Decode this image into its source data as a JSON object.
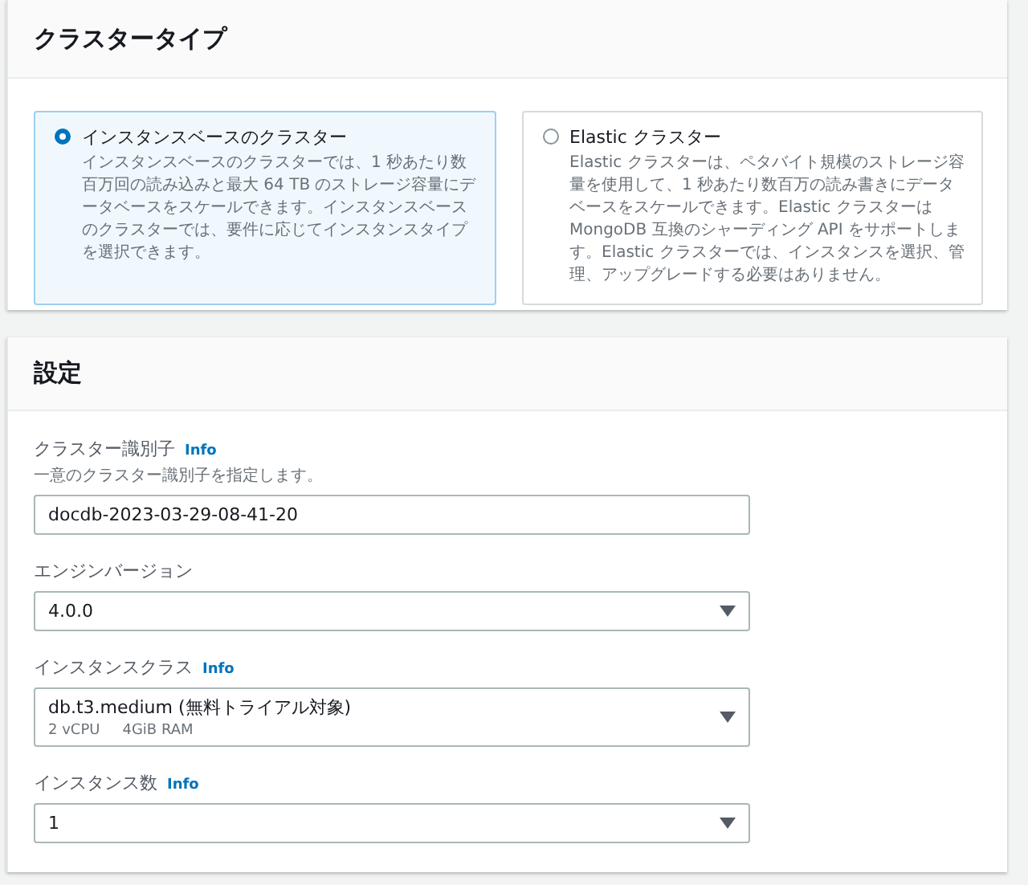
{
  "cluster_type": {
    "title": "クラスタータイプ",
    "options": [
      {
        "label": "インスタンスベースのクラスター",
        "description": "インスタンスベースのクラスターでは、1 秒あたり数百万回の読み込みと最大 64 TB のストレージ容量にデータベースをスケールできます。インスタンスベースのクラスターでは、要件に応じてインスタンスタイプを選択できます。",
        "selected": true
      },
      {
        "label": "Elastic クラスター",
        "description": "Elastic クラスターは、ペタバイト規模のストレージ容量を使用して、1 秒あたり数百万の読み書きにデータベースをスケールできます。Elastic クラスターは MongoDB 互換のシャーディング API をサポートします。Elastic クラスターでは、インスタンスを選択、管理、アップグレードする必要はありません。",
        "selected": false
      }
    ]
  },
  "settings": {
    "title": "設定",
    "fields": [
      {
        "label": "クラスター識別子",
        "info": "Info",
        "description": "一意のクラスター識別子を指定します。",
        "kind": "input",
        "value": "docdb-2023-03-29-08-41-20"
      },
      {
        "label": "エンジンバージョン",
        "kind": "select",
        "value": "4.0.0"
      },
      {
        "label": "インスタンスクラス",
        "info": "Info",
        "kind": "select",
        "value": "db.t3.medium (無料トライアル対象)",
        "details": [
          "2 vCPU",
          "4GiB RAM"
        ]
      },
      {
        "label": "インスタンス数",
        "info": "Info",
        "kind": "select",
        "value": "1"
      }
    ]
  }
}
